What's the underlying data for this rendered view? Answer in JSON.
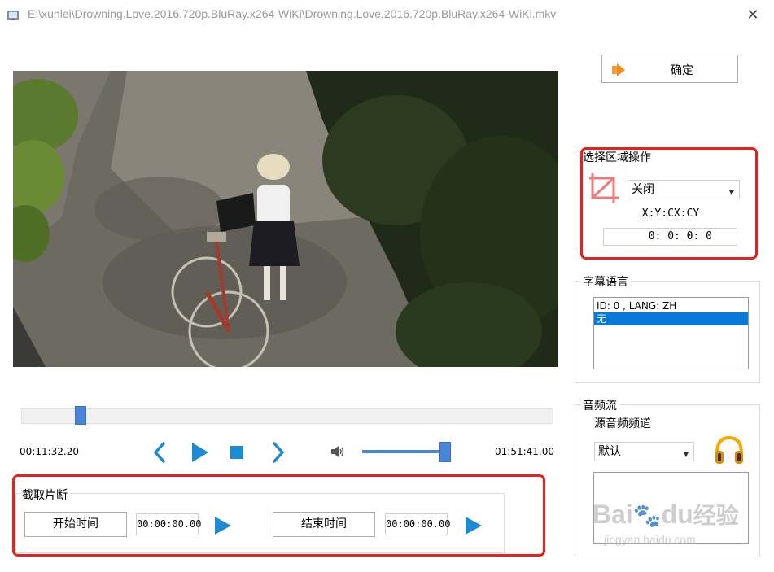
{
  "window": {
    "title": "E:\\xunlei\\Drowning.Love.2016.720p.BluRay.x264-WiKi\\Drowning.Love.2016.720p.BluRay.x264-WiKi.mkv",
    "close_glyph": "✕"
  },
  "player": {
    "current_time": "00:11:32.20",
    "total_time": "01:51:41.00",
    "seek_position": 0.11,
    "volume_level": 0.97
  },
  "ok_button": {
    "label": "确定"
  },
  "region": {
    "title": "选择区域操作",
    "mode_value": "关闭",
    "coord_label": "X:Y:CX:CY",
    "coord_value": "0:  0:  0:  0"
  },
  "subtitle": {
    "title": "字幕语言",
    "items": [
      "ID: 0 , LANG: ZH",
      "无"
    ],
    "selected_index": 1
  },
  "audio": {
    "title": "音频流",
    "source_label": "源音频频道",
    "channel_value": "默认"
  },
  "clip": {
    "title": "截取片断",
    "start_label": "开始时间",
    "start_value": "00:00:00.00",
    "end_label": "结束时间",
    "end_value": "00:00:00.00"
  },
  "watermark": {
    "brand": "Bai",
    "brand2": "du",
    "cn": "经验",
    "url": "jingyan.baidu.com"
  },
  "colors": {
    "accent": "#1f8ad4",
    "highlight": "#e8201a",
    "selection": "#0a78d7"
  }
}
